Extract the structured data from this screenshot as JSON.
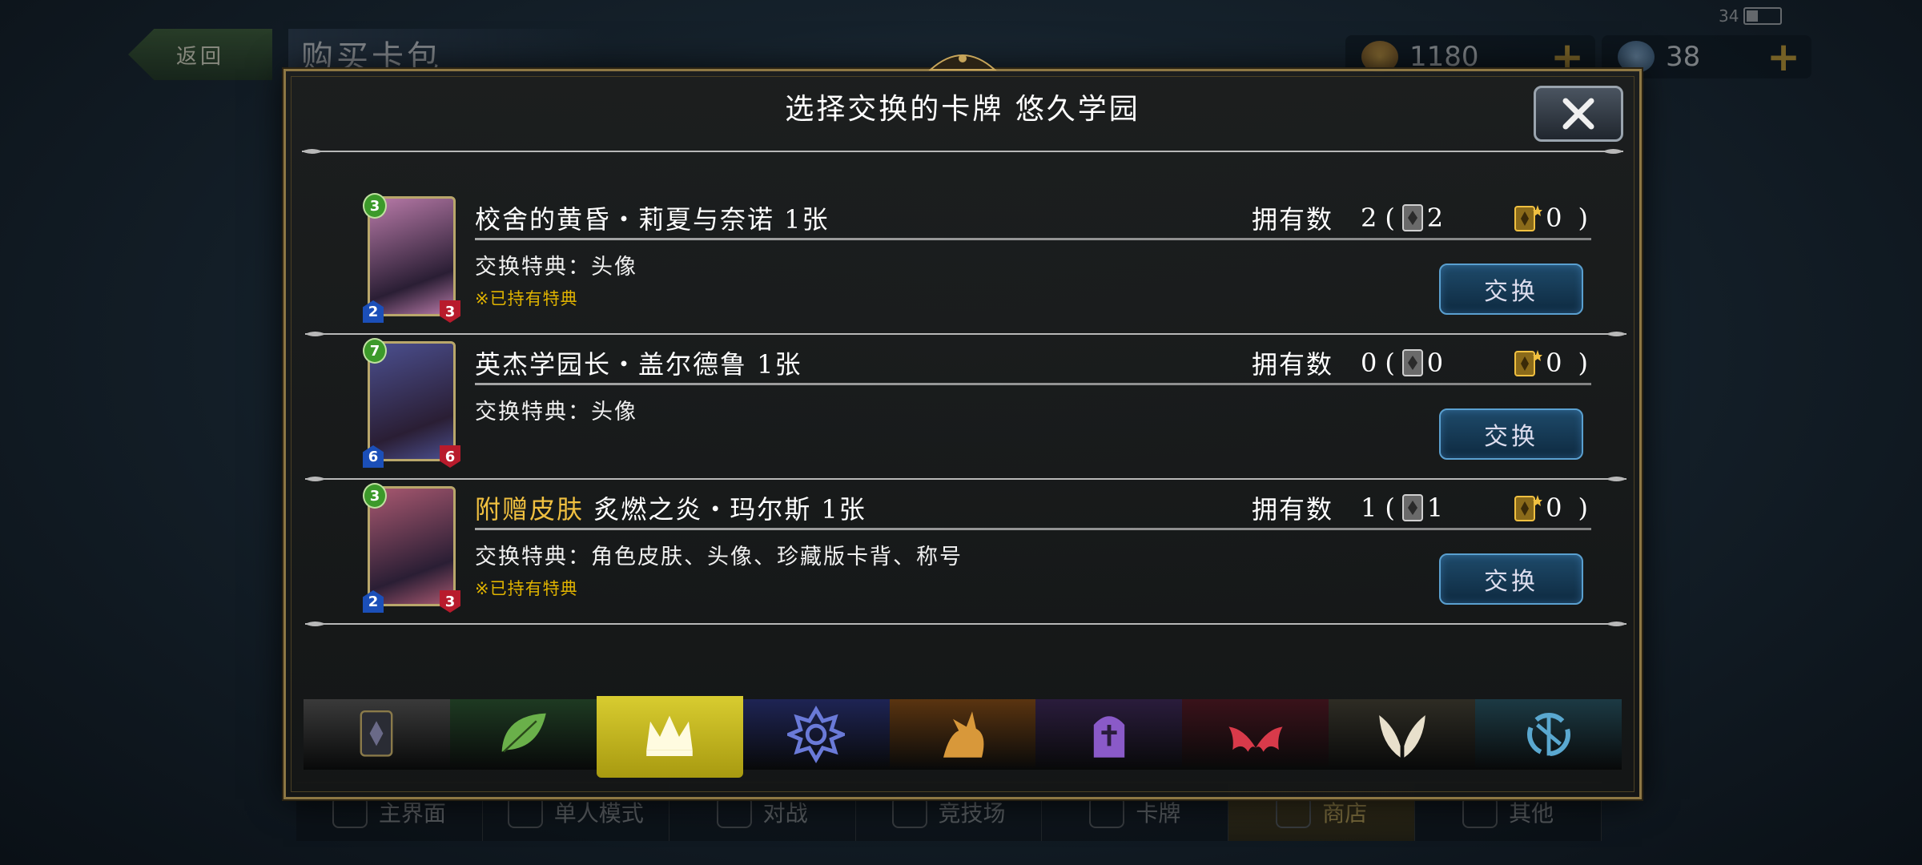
{
  "background": {
    "back_label": "返回",
    "page_title": "购买卡包",
    "gold": "1180",
    "crystals": "38",
    "battery": "34",
    "nav": [
      {
        "label": "主界面"
      },
      {
        "label": "单人模式"
      },
      {
        "label": "对战"
      },
      {
        "label": "竞技场"
      },
      {
        "label": "卡牌"
      },
      {
        "label": "商店"
      },
      {
        "label": "其他"
      }
    ]
  },
  "dialog": {
    "title": "选择交换的卡牌 悠久学园",
    "owned_label": "拥有数",
    "exchange_label": "交换",
    "rows": [
      {
        "tag": "",
        "name": "校舍的黄昏・莉夏与奈诺 1张",
        "owned": "2",
        "normal": "2",
        "premium": "0",
        "bonus": "交换特典：头像",
        "note": "※已持有特典",
        "cost": "3",
        "atk": "2",
        "def": "3",
        "art_color": "#b87aa8"
      },
      {
        "tag": "",
        "name": "英杰学园长・盖尔德鲁 1张",
        "owned": "0",
        "normal": "0",
        "premium": "0",
        "bonus": "交换特典：头像",
        "note": "",
        "cost": "7",
        "atk": "6",
        "def": "6",
        "art_color": "#4b4f8f"
      },
      {
        "tag": "附赠皮肤",
        "name": " 炙燃之炎・玛尔斯 1张",
        "owned": "1",
        "normal": "1",
        "premium": "0",
        "bonus": "交换特典：角色皮肤、头像、珍藏版卡背、称号",
        "note": "※已持有特典",
        "cost": "3",
        "atk": "2",
        "def": "3",
        "art_color": "#a85870"
      }
    ],
    "tabs": [
      {
        "name": "neutral",
        "icon": "card-back-icon",
        "color": "#3a3a3a"
      },
      {
        "name": "forestcraft",
        "icon": "leaf-icon",
        "color": "#1e3a22"
      },
      {
        "name": "swordcraft",
        "icon": "crown-icon",
        "color": "#c8b820"
      },
      {
        "name": "runecraft",
        "icon": "rune-star-icon",
        "color": "#1e2454"
      },
      {
        "name": "dragoncraft",
        "icon": "dragon-icon",
        "color": "#5a3410"
      },
      {
        "name": "shadowcraft",
        "icon": "tombstone-icon",
        "color": "#2a1c3c"
      },
      {
        "name": "bloodcraft",
        "icon": "bat-wings-icon",
        "color": "#3a121a"
      },
      {
        "name": "havencraft",
        "icon": "angel-wings-icon",
        "color": "#2e2c24"
      },
      {
        "name": "portalcraft",
        "icon": "portal-icon",
        "color": "#1c3a44"
      }
    ]
  }
}
